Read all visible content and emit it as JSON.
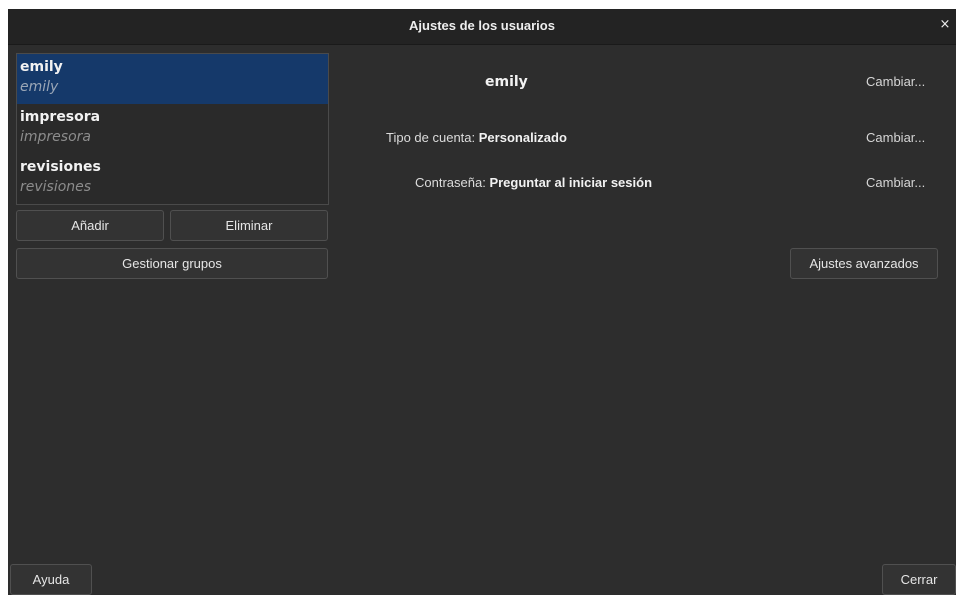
{
  "window": {
    "title": "Ajustes de los usuarios",
    "close_glyph": "×"
  },
  "users": [
    {
      "name": "emily",
      "login": "emily",
      "selected": true
    },
    {
      "name": "impresora",
      "login": "impresora",
      "selected": false
    },
    {
      "name": "revisiones",
      "login": "revisiones",
      "selected": false
    }
  ],
  "list_buttons": {
    "add": "Añadir",
    "remove": "Eliminar",
    "manage_groups": "Gestionar grupos"
  },
  "details": {
    "username": "emily",
    "account_type_label": "Tipo de cuenta:",
    "account_type_value": "Personalizado",
    "password_label": "Contraseña:",
    "password_value": "Preguntar al iniciar sesión",
    "change_label": "Cambiar...",
    "advanced_settings": "Ajustes avanzados"
  },
  "footer": {
    "help": "Ayuda",
    "close": "Cerrar"
  }
}
